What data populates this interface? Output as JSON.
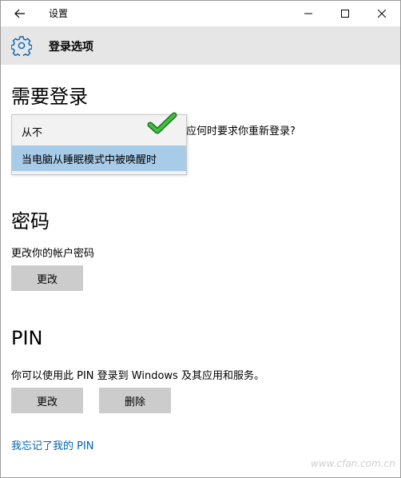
{
  "titlebar": {
    "title": "设置"
  },
  "header": {
    "title": "登录选项"
  },
  "require_login": {
    "heading": "需要登录",
    "question_tail": "应何时要求你重新登录?",
    "options": [
      "从不",
      "当电脑从睡眠模式中被唤醒时"
    ],
    "selected_index": 1
  },
  "password": {
    "heading": "密码",
    "description": "更改你的帐户密码",
    "change_label": "更改"
  },
  "pin": {
    "heading": "PIN",
    "description": "你可以使用此 PIN 登录到 Windows 及其应用和服务。",
    "change_label": "更改",
    "delete_label": "删除",
    "forgot_link": "我忘记了我的 PIN"
  },
  "watermark": "www.cfan.com.cn",
  "colors": {
    "header_bg": "#e6e6e6",
    "button_bg": "#cccccc",
    "link": "#0063b1",
    "selected_bg": "#a8cbe8",
    "check": "#2e9e2e"
  }
}
